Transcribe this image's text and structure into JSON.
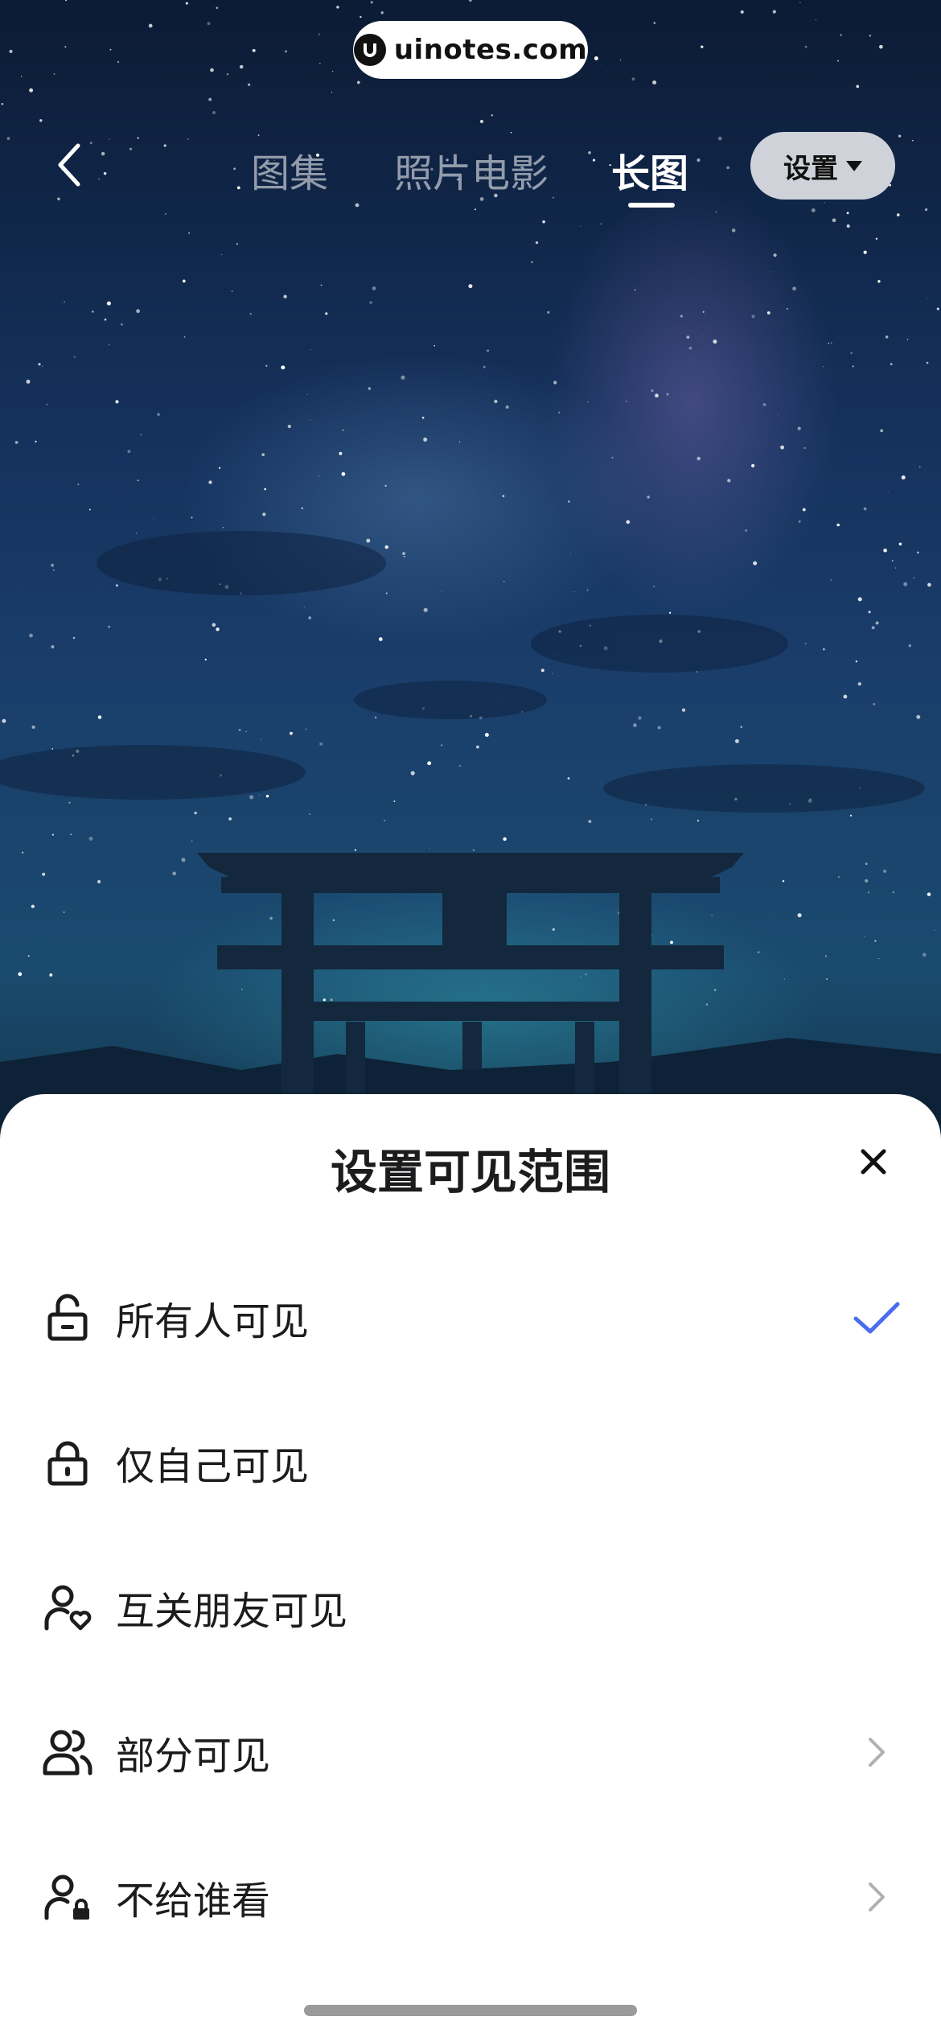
{
  "watermark": {
    "text": "uinotes.com"
  },
  "nav": {
    "tabs": [
      {
        "label": "图集",
        "active": false
      },
      {
        "label": "照片电影",
        "active": false
      },
      {
        "label": "长图",
        "active": true
      }
    ],
    "settings_label": "设置"
  },
  "sheet": {
    "title": "设置可见范围",
    "options": [
      {
        "label": "所有人可见",
        "icon": "unlock-icon",
        "selected": true
      },
      {
        "label": "仅自己可见",
        "icon": "lock-icon",
        "selected": false
      },
      {
        "label": "互关朋友可见",
        "icon": "user-heart-icon",
        "selected": false
      },
      {
        "label": "部分可见",
        "icon": "users-icon",
        "selected": false,
        "has_arrow": true
      },
      {
        "label": "不给谁看",
        "icon": "user-lock-icon",
        "selected": false,
        "has_arrow": true
      }
    ]
  },
  "colors": {
    "accent": "#4a6cf0",
    "text": "#1c1c1e",
    "sheet_bg": "#ffffff"
  }
}
